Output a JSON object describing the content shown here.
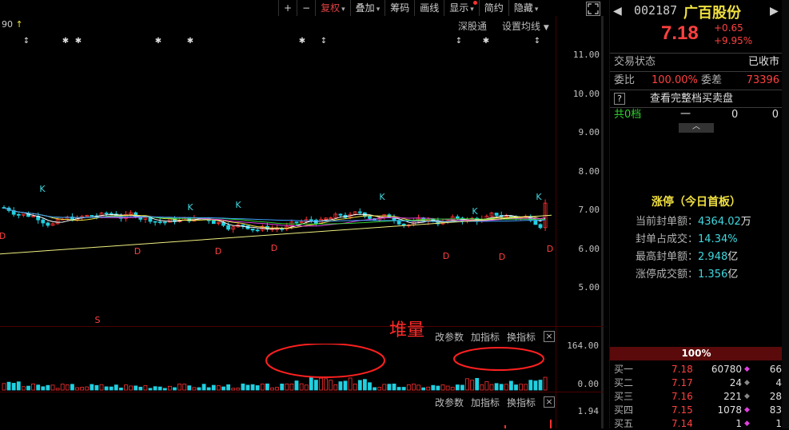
{
  "toolbar": {
    "items": [
      {
        "label": "+",
        "arrow": false
      },
      {
        "label": "−",
        "arrow": false
      },
      {
        "label": "复权",
        "arrow": true,
        "active": true
      },
      {
        "label": "叠加",
        "arrow": true
      },
      {
        "label": "筹码",
        "arrow": false
      },
      {
        "label": "画线",
        "arrow": false
      },
      {
        "label": "显示",
        "arrow": true,
        "dot": true
      },
      {
        "label": "简约",
        "arrow": false
      },
      {
        "label": "隐藏",
        "arrow": true
      }
    ],
    "expand_icon": "expand-icon"
  },
  "main_chart": {
    "top_left_value": "90",
    "top_left_arrow": "↑",
    "shenguotong": "深股通",
    "ma_settings": "设置均线",
    "y_ticks": [
      "11.00",
      "10.00",
      "9.00",
      "8.00",
      "7.00",
      "6.00",
      "5.00"
    ],
    "k_labels": [
      "K",
      "K",
      "K",
      "K",
      "K",
      "K"
    ],
    "d_labels": [
      "D",
      "D",
      "D",
      "D",
      "D",
      "D",
      "D"
    ],
    "s_marker": "S"
  },
  "volume_panel": {
    "annotation": "堆量",
    "btn_params": "改参数",
    "btn_add": "加指标",
    "btn_switch": "换指标",
    "close": "×",
    "y_ticks": [
      "164.00",
      "0.00"
    ]
  },
  "macd_panel": {
    "btn_params": "改参数",
    "btn_add": "加指标",
    "btn_switch": "换指标",
    "close": "×",
    "y_tick": "1.94"
  },
  "quote": {
    "code": "002187",
    "name": "广百股份",
    "price": "7.18",
    "change": "+0.65",
    "change_pct": "+9.95%",
    "status_label": "交易状态",
    "status_value": "已收市",
    "wb_label": "委比",
    "wb_value": "100.00%",
    "wc_label": "委差",
    "wc_value": "73396",
    "full_book": "查看完整档买卖盘",
    "q_mark": "?",
    "levels_label": "共0档",
    "levels_dash": "一",
    "levels_a": "0",
    "levels_b": "0"
  },
  "limit_up": {
    "title": "涨停（今日首板）",
    "rows": [
      {
        "label": "当前封单额：",
        "value": "4364.02",
        "unit": "万"
      },
      {
        "label": "封单占成交：",
        "value": "14.34%",
        "unit": ""
      },
      {
        "label": "最高封单额：",
        "value": "2.948",
        "unit": "亿"
      },
      {
        "label": "涨停成交额：",
        "value": "1.356",
        "unit": "亿"
      }
    ]
  },
  "order_book": {
    "ratio": "100%",
    "bids": [
      {
        "label": "买一",
        "price": "7.18",
        "vol": "60780",
        "count": "66"
      },
      {
        "label": "买二",
        "price": "7.17",
        "vol": "24",
        "count": "4"
      },
      {
        "label": "买三",
        "price": "7.16",
        "vol": "221",
        "count": "28"
      },
      {
        "label": "买四",
        "price": "7.15",
        "vol": "1078",
        "count": "83"
      },
      {
        "label": "买五",
        "price": "7.14",
        "vol": "1",
        "count": "1"
      }
    ]
  },
  "colors": {
    "up": "#ff4040",
    "down": "#30d030",
    "accent": "#40d8e0",
    "bg": "#000000"
  }
}
